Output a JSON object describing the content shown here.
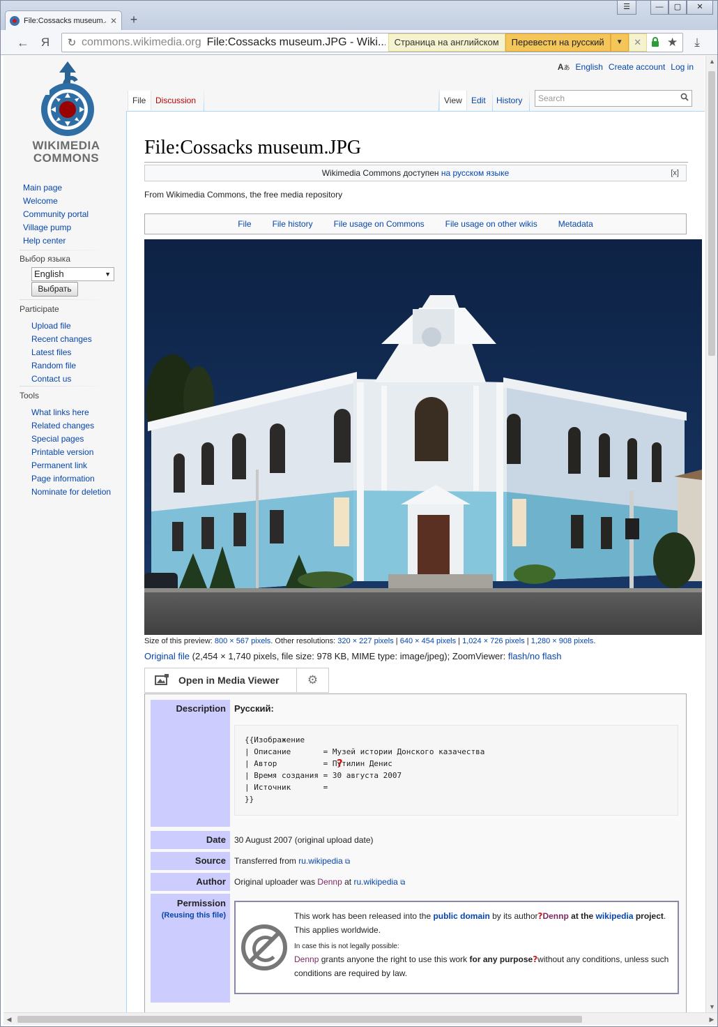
{
  "browser": {
    "tab_title": "File:Cossacks museum.JF",
    "tab_close": "✕",
    "new_tab": "+",
    "url_domain": "commons.wikimedia.org",
    "url_title": "File:Cossacks museum.JPG - Wiki...",
    "nav_back": "←",
    "nav_yandex": "Я",
    "translate_lang": "Страница на английском",
    "translate_button": "Перевести на русский",
    "translate_dropdown": "▼",
    "translate_close": "✕",
    "download": "⤓",
    "win_menu": "☰",
    "win_min": "—",
    "win_max": "▢",
    "win_close": "✕"
  },
  "logo": {
    "line1": "WIKIMEDIA",
    "line2": "COMMONS"
  },
  "sidebar": {
    "nav_items": [
      "Main page",
      "Welcome",
      "Community portal",
      "Village pump",
      "Help center"
    ],
    "lang_heading": "Выбор языка",
    "lang_selected": "English",
    "lang_button": "Выбрать",
    "participate_heading": "Participate",
    "participate_items": [
      "Upload file",
      "Recent changes",
      "Latest files",
      "Random file",
      "Contact us"
    ],
    "tools_heading": "Tools",
    "tools_items": [
      "What links here",
      "Related changes",
      "Special pages",
      "Printable version",
      "Permanent link",
      "Page information",
      "Nominate for deletion"
    ]
  },
  "personal": {
    "language": "English",
    "create_account": "Create account",
    "log_in": "Log in"
  },
  "tabs": {
    "file": "File",
    "discussion": "Discussion",
    "view": "View",
    "edit": "Edit",
    "history": "History",
    "search_placeholder": "Search"
  },
  "content": {
    "heading": "File:Cossacks museum.JPG",
    "notice_text": "Wikimedia Commons доступен ",
    "notice_link": "на русском языке",
    "notice_close": "[x]",
    "site_sub": "From Wikimedia Commons, the free media repository",
    "filetoc": [
      "File",
      "File history",
      "File usage on Commons",
      "File usage on other wikis",
      "Metadata"
    ],
    "size_prefix": "Size of this preview: ",
    "size_current": "800 × 567 pixels",
    "size_other": ". Other resolutions: ",
    "res_1": "320 × 227 pixels",
    "res_2": "640 × 454 pixels",
    "res_3": "1,024 × 726 pixels",
    "res_4": "1,280 × 908 pixels",
    "sep": " | ",
    "dot": ".",
    "orig_link": "Original file",
    "orig_text": " (2,454 × 1,740 pixels, file size: 978 KB, MIME type: image/jpeg); ZoomViewer: ",
    "orig_flash": "flash/no flash",
    "mmv_open": "Open in Media Viewer"
  },
  "info": {
    "description_label": "Description",
    "description_lang": "Русский:",
    "template_lines": [
      "{{Изображение",
      "| Описание       = Музей истории Донского казачества",
      "| Автор          = Путилин Денис",
      "| Время создания = 30 августа 2007",
      "| Источник       =",
      "}}"
    ],
    "date_label": "Date",
    "date_value": "30 August 2007 (original upload date)",
    "source_label": "Source",
    "source_prefix": "Transferred from ",
    "source_link": "ru.wikipedia",
    "author_label": "Author",
    "author_prefix": "Original uploader was ",
    "author_user": "Dennp",
    "author_at": " at ",
    "author_link": "ru.wikipedia",
    "permission_label": "Permission",
    "reusing": "(Reusing this file)",
    "pd_line1_a": "This work has been released into the ",
    "pd_link_pd": "public domain",
    "pd_line1_b": " by its author",
    "pd_user": "Dennp",
    "pd_line1_c": " at the ",
    "pd_link_wiki": "wikipedia",
    "pd_line1_d": " project",
    "pd_line1_e": ". This applies worldwide.",
    "pd_small": "In case this is not legally possible:",
    "pd_line2_a": " grants anyone the right to use this work ",
    "pd_line2_b": "for any purpose",
    "pd_line2_c": "without any conditions, unless such conditions are required by law."
  },
  "colors": {
    "link": "#0645ad",
    "redlink": "#ba0000",
    "label_bg": "#ccccff",
    "sky": "#0d2244"
  }
}
